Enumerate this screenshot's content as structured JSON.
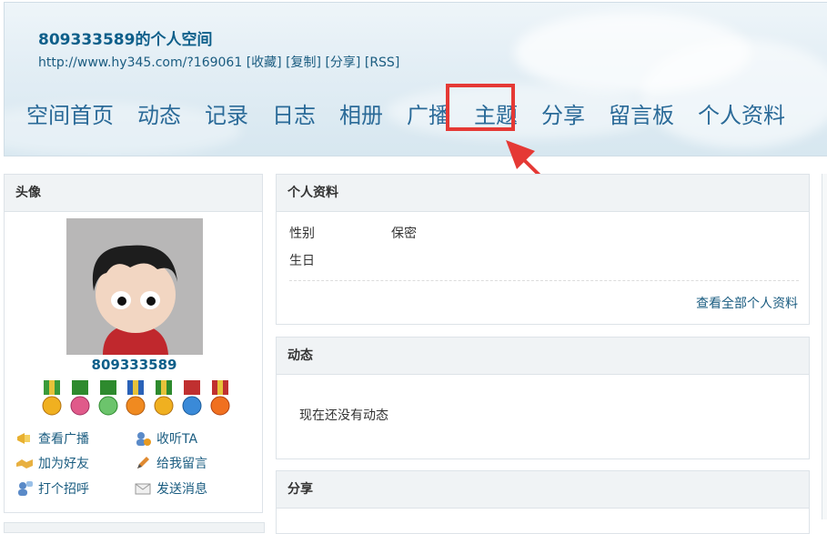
{
  "header": {
    "title": "809333589的个人空间",
    "url": "http://www.hy345.com/?169061",
    "links": [
      "[收藏]",
      "[复制]",
      "[分享]",
      "[RSS]"
    ]
  },
  "nav": {
    "items": [
      "空间首页",
      "动态",
      "记录",
      "日志",
      "相册",
      "广播",
      "主题",
      "分享",
      "留言板",
      "个人资料"
    ],
    "highlighted": "主题",
    "highlight_color": "#e53935"
  },
  "avatar_panel": {
    "heading": "头像",
    "username": "809333589",
    "actions": [
      {
        "label": "查看广播",
        "icon": "megaphone-icon"
      },
      {
        "label": "收听TA",
        "icon": "follow-user-icon"
      },
      {
        "label": "加为好友",
        "icon": "handshake-icon"
      },
      {
        "label": "给我留言",
        "icon": "pencil-icon"
      },
      {
        "label": "打个招呼",
        "icon": "greet-user-icon"
      },
      {
        "label": "发送消息",
        "icon": "envelope-icon"
      }
    ]
  },
  "profile_panel": {
    "heading": "个人资料",
    "gender_label": "性别",
    "gender_value": "保密",
    "birthday_label": "生日",
    "view_all": "查看全部个人资料"
  },
  "feed_panel": {
    "heading": "动态",
    "empty_text": "现在还没有动态"
  },
  "share_panel": {
    "heading": "分享"
  },
  "colors": {
    "link": "#1a5c80",
    "nav": "#2a6a98",
    "title": "#0e5f8a",
    "panel_head_bg": "#f0f3f5"
  }
}
